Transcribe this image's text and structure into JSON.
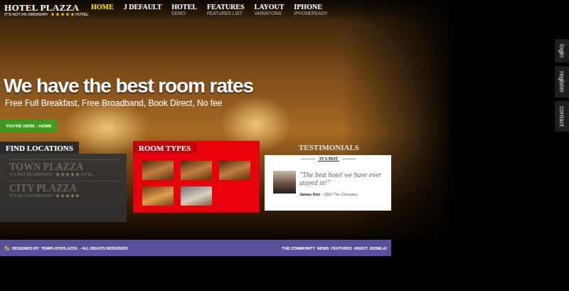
{
  "logo": {
    "title": "HOTEL PLAZZA",
    "tagline_before": "IT'S NOT AN ORDINARY",
    "stars": 5,
    "tagline_after": "HOTEL"
  },
  "nav": [
    {
      "label": "HOME",
      "sub": "",
      "selected": true
    },
    {
      "label": "J DEFAULT",
      "sub": "",
      "selected": false
    },
    {
      "label": "HOTEL",
      "sub": "DEMO",
      "selected": false
    },
    {
      "label": "FEATURES",
      "sub": "FEATURES LIST",
      "selected": false
    },
    {
      "label": "LAYOUT",
      "sub": "VARIATIONS",
      "selected": false
    },
    {
      "label": "IPHONE",
      "sub": "IPHONEREADY",
      "selected": false
    }
  ],
  "side_tabs": [
    "login",
    "register",
    "contact"
  ],
  "hero": {
    "headline": "We have the best room rates",
    "subline": "Free Full Breakfast, Free Broadband, Book Direct, No fee"
  },
  "breadcrumb": "YOU'RE HERE : HOME",
  "locations": {
    "title": "FIND LOCATIONS",
    "items": [
      {
        "name": "TOWN PLAZZA",
        "tagline_before": "IT'S NOT AN ORDINARY",
        "stars": 5,
        "tagline_after": "HOTEL"
      },
      {
        "name": "CITY PLAZZA",
        "tagline_before": "IT'S NOT AN ORDINARY",
        "stars": 5,
        "tagline_after": ""
      }
    ]
  },
  "room_types": {
    "title": "ROOM TYPES",
    "thumbnails": 5
  },
  "testimonials": {
    "title": "TESTIMONIALS",
    "badge": "IT'S HOT",
    "quote": "\"The best hotel we have ever stayed in!\"",
    "author": "James Ken",
    "role": "- CEO The Company"
  },
  "footer": {
    "credit_prefix": "DESIGNED BY",
    "credit_brand": "TEMPLATEPLAZZA",
    "credit_suffix": "- ALL RIGHTS RESERVED",
    "links": [
      "THE COMMUNITY",
      "NEWS",
      "FEATURES",
      "ABOUT JOOMLA!"
    ]
  }
}
